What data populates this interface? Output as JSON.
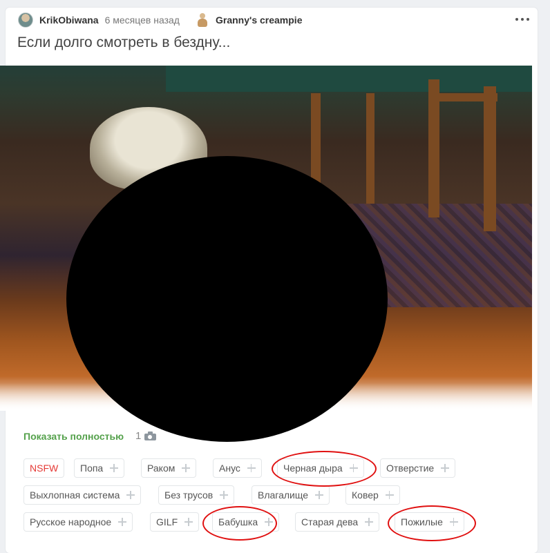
{
  "post": {
    "author": "KrikObiwana",
    "time": "6 месяцев назад",
    "community": "Granny's creampie",
    "title": "Если долго смотреть в бездну..."
  },
  "media": {
    "show_more": "Показать полностью",
    "photo_count": "1"
  },
  "tags": [
    "NSFW",
    "Попа",
    "Раком",
    "Анус",
    "Черная дыра",
    "Отверстие",
    "Выхлопная система",
    "Без трусов",
    "Влагалище",
    "Ковер",
    "Русское народное",
    "GILF",
    "Бабушка",
    "Старая дева",
    "Пожилые"
  ],
  "colors": {
    "nsfw": "#e53935",
    "show_more": "#54a14b",
    "annotation": "#e01010"
  },
  "icons": [
    "avatar",
    "community-avatar-icon",
    "more-icon",
    "camera-icon",
    "plus-icon"
  ]
}
